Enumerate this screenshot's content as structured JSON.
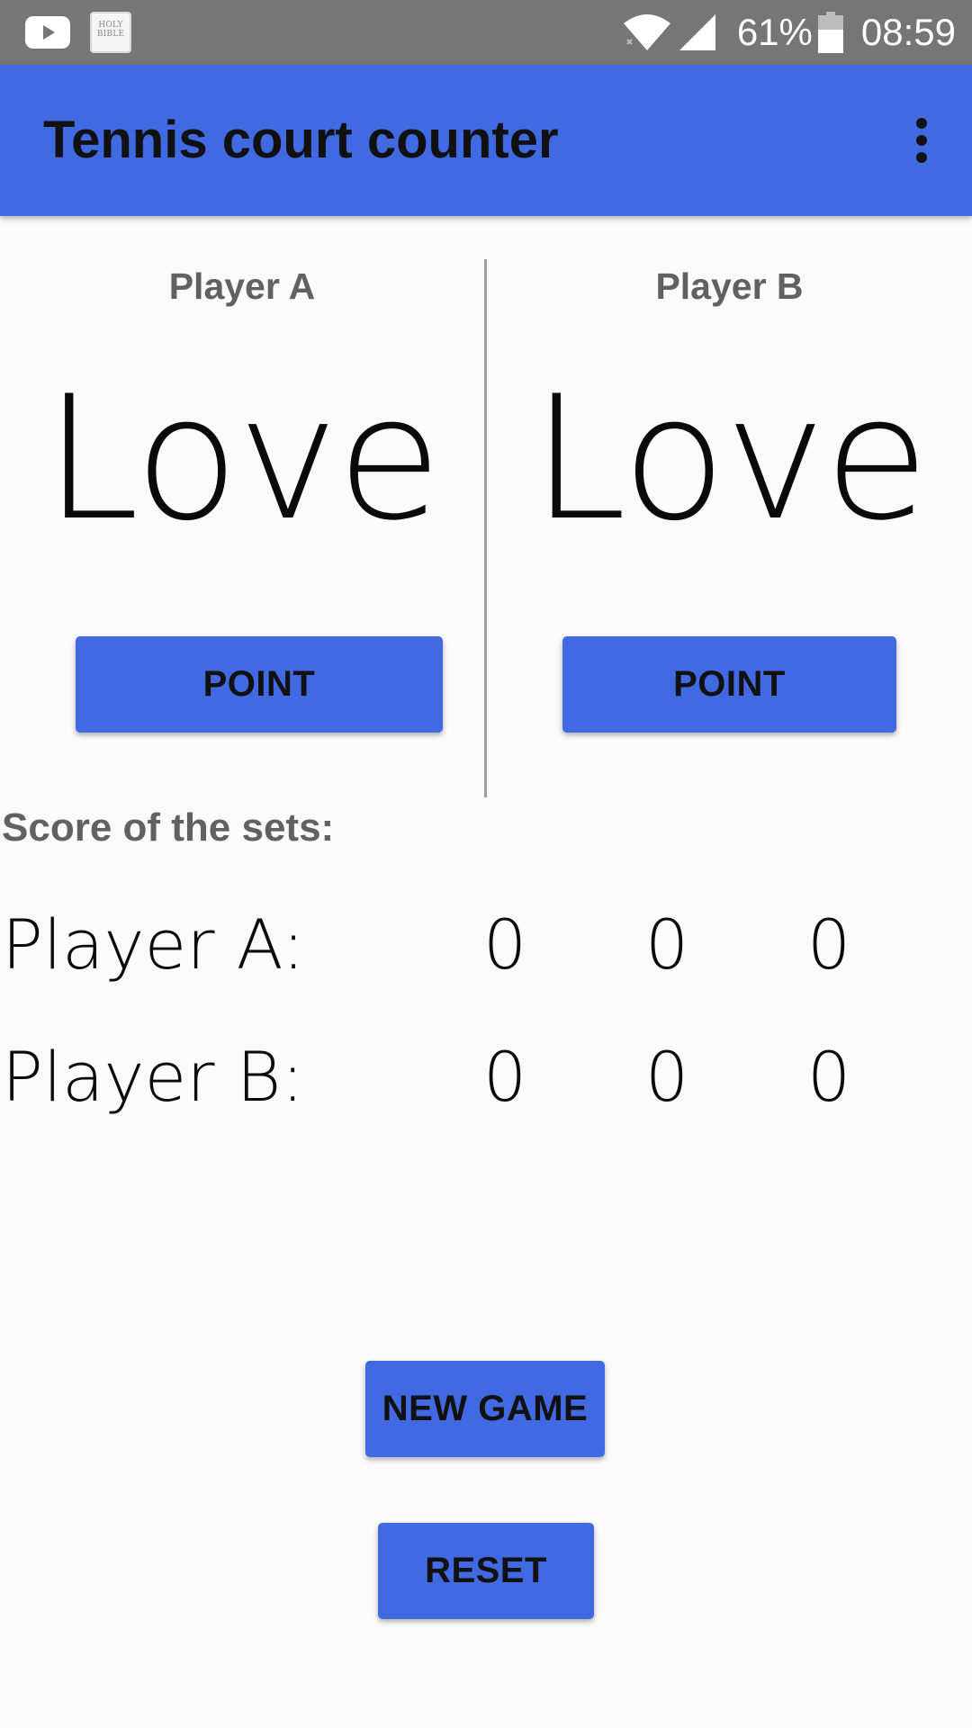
{
  "status_bar": {
    "bible_icon_text": "HOLY BIBLE",
    "battery_percent": "61%",
    "time": "08:59"
  },
  "app_bar": {
    "title": "Tennis court counter"
  },
  "players": [
    {
      "label": "Player A",
      "score": "Love",
      "point_label": "POINT"
    },
    {
      "label": "Player B",
      "score": "Love",
      "point_label": "POINT"
    }
  ],
  "sets": {
    "title": "Score of the sets:",
    "rows": [
      {
        "label": "Player A:",
        "values": [
          "0",
          "0",
          "0"
        ]
      },
      {
        "label": "Player B:",
        "values": [
          "0",
          "0",
          "0"
        ]
      }
    ]
  },
  "actions": {
    "new_game_label": "NEW GAME",
    "reset_label": "RESET"
  },
  "colors": {
    "accent": "#4169e1",
    "status_bar": "#767676",
    "background": "#fafafa"
  }
}
